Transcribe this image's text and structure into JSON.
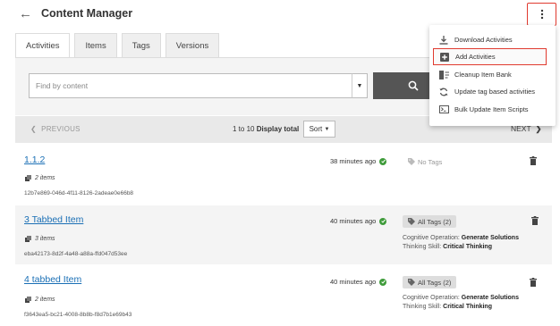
{
  "header": {
    "title": "Content Manager"
  },
  "tabs": [
    {
      "label": "Activities"
    },
    {
      "label": "Items"
    },
    {
      "label": "Tags"
    },
    {
      "label": "Versions"
    }
  ],
  "search": {
    "placeholder": "Find by content"
  },
  "pager": {
    "prev_label": "PREVIOUS",
    "range_text": "1 to 10",
    "display_label": "Display total",
    "sort_label": "Sort",
    "next_label": "NEXT"
  },
  "menu": {
    "items": [
      {
        "label": "Download Activities",
        "icon": "download-icon"
      },
      {
        "label": "Add Activities",
        "icon": "plus-box-icon"
      },
      {
        "label": "Cleanup Item Bank",
        "icon": "cleanup-icon"
      },
      {
        "label": "Update tag based activities",
        "icon": "refresh-icon"
      },
      {
        "label": "Bulk Update Item Scripts",
        "icon": "terminal-icon"
      }
    ]
  },
  "rows": [
    {
      "title": "1.1.2",
      "count": "2 items",
      "id": "12b7e869-046d-4f11-8126-2adeae0e66b8",
      "time": "38 minutes ago",
      "tags": "No Tags"
    },
    {
      "title": "3 Tabbed Item",
      "count": "3 items",
      "id": "eba42173-8d2f-4a48-a88a-ffd047d53ee",
      "time": "40 minutes ago",
      "tags": "All Tags (2)",
      "meta": [
        {
          "key": "Cognitive Operation:",
          "value": "Generate Solutions"
        },
        {
          "key": "Thinking Skill:",
          "value": "Critical Thinking"
        }
      ]
    },
    {
      "title": "4 tabbed Item",
      "count": "2 items",
      "id": "f3643ea5-bc21-4008-8b8b-f8d7b1e69b43",
      "time": "40 minutes ago",
      "tags": "All Tags (2)",
      "meta": [
        {
          "key": "Cognitive Operation:",
          "value": "Generate Solutions"
        },
        {
          "key": "Thinking Skill:",
          "value": "Critical Thinking"
        }
      ]
    }
  ]
}
